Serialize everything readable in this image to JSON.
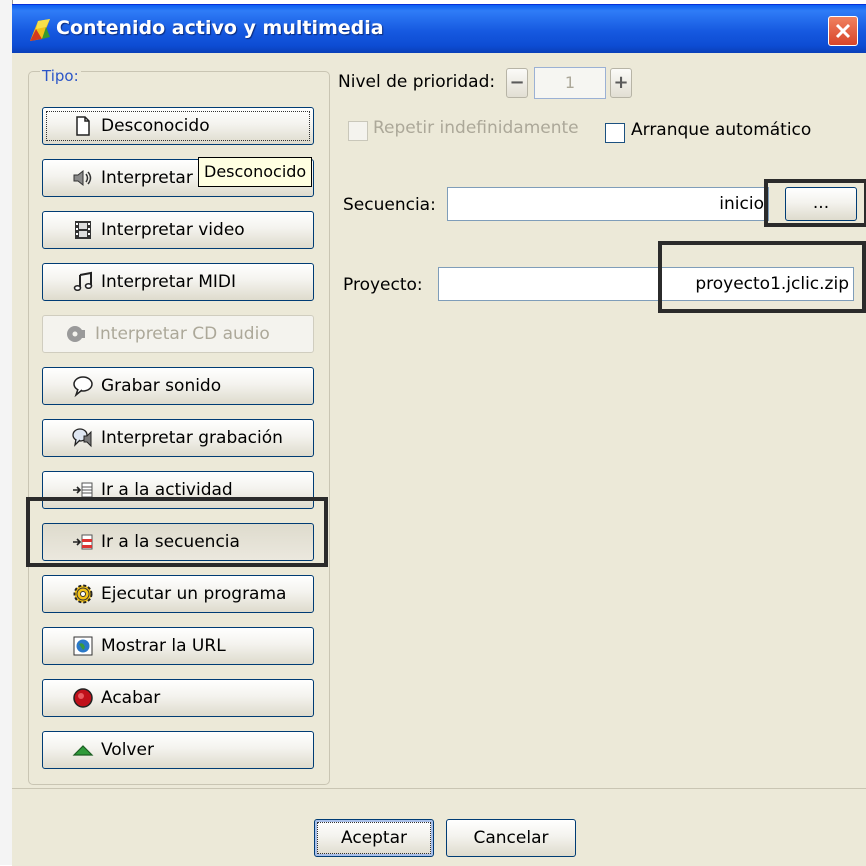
{
  "window": {
    "title": "Contenido activo y multimedia",
    "close_icon": "close-x-icon"
  },
  "tipo": {
    "label": "Tipo:",
    "buttons": [
      {
        "label": "Desconocido",
        "icon": "document-icon"
      },
      {
        "label": "Interpretar",
        "icon": "speaker-icon"
      },
      {
        "label": "Interpretar video",
        "icon": "film-icon"
      },
      {
        "label": "Interpretar MIDI",
        "icon": "music-note-icon"
      },
      {
        "label": "Interpretar CD audio",
        "icon": "cd-icon"
      },
      {
        "label": "Grabar sonido",
        "icon": "speech-bubble-icon"
      },
      {
        "label": "Interpretar grabación",
        "icon": "speech-speaker-icon"
      },
      {
        "label": "Ir a la actividad",
        "icon": "arrow-list-icon"
      },
      {
        "label": "Ir a la secuencia",
        "icon": "arrow-list-red-icon"
      },
      {
        "label": "Ejecutar un programa",
        "icon": "gear-icon"
      },
      {
        "label": "Mostrar la URL",
        "icon": "globe-icon"
      },
      {
        "label": "Acabar",
        "icon": "stop-icon"
      },
      {
        "label": "Volver",
        "icon": "triangle-up-icon"
      }
    ],
    "tooltip": "Desconocido"
  },
  "priority": {
    "label": "Nivel de prioridad:",
    "minus": "−",
    "value": "1",
    "plus": "+"
  },
  "options": {
    "repeat_label": "Repetir indefinidamente",
    "repeat_checked": false,
    "autostart_label": "Arranque automático",
    "autostart_checked": false
  },
  "sequence": {
    "label": "Secuencia:",
    "value": "inicio",
    "browse_label": "..."
  },
  "project": {
    "label": "Proyecto:",
    "value": "proyecto1.jclic.zip"
  },
  "footer": {
    "accept_label": "Aceptar",
    "cancel_label": "Cancelar"
  },
  "colors": {
    "titlebar": "#0d4cd3",
    "dialog_bg": "#ece9d8",
    "button_border": "#003c74",
    "highlight_box": "#2b2b2b"
  }
}
